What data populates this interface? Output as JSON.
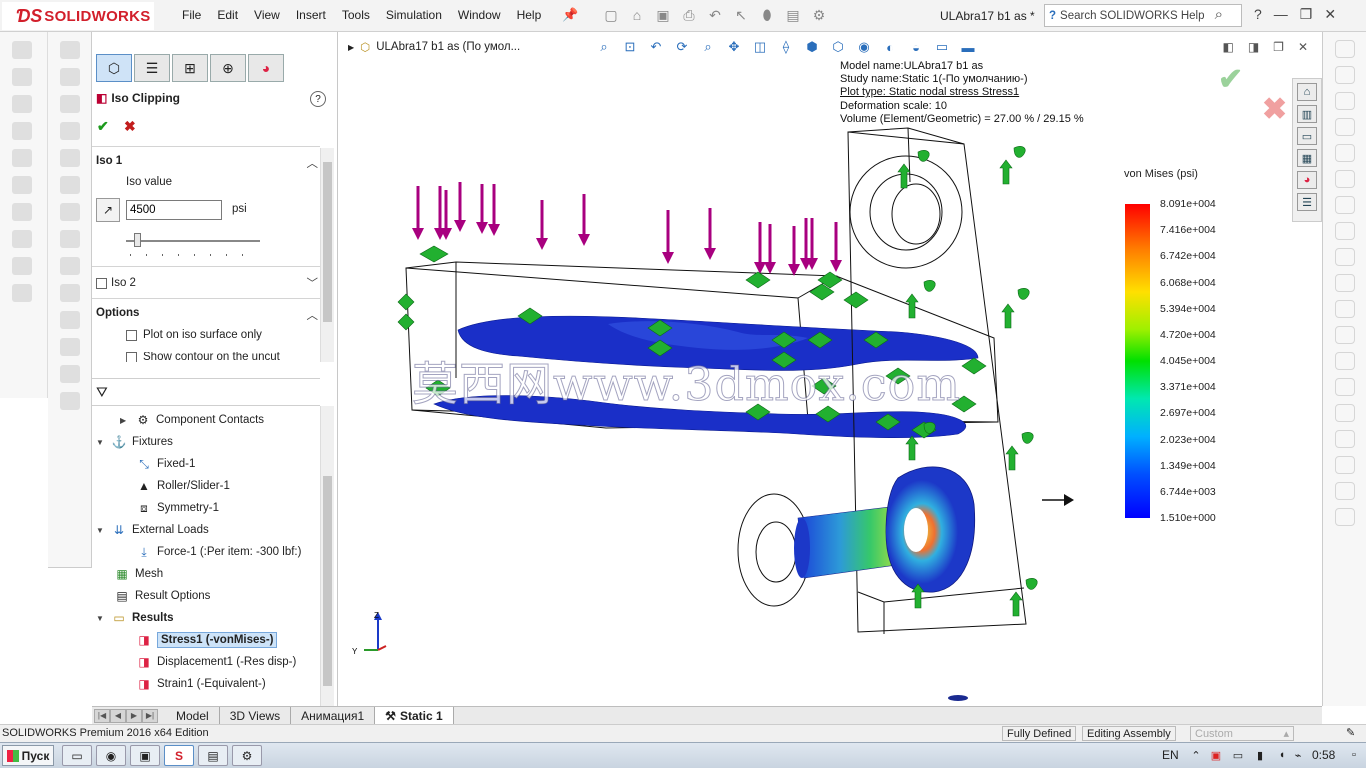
{
  "app": {
    "brand": "SOLIDWORKS",
    "menu": [
      "File",
      "Edit",
      "View",
      "Insert",
      "Tools",
      "Simulation",
      "Window",
      "Help"
    ],
    "doc_title": "ULAbra17 b1 as *",
    "search_placeholder": "Search SOLIDWORKS Help",
    "help_mark": "?"
  },
  "property_manager": {
    "title": "Iso Clipping",
    "iso1": {
      "label": "Iso 1",
      "value_label": "Iso value",
      "value": "4500",
      "unit": "psi",
      "slider_fraction": 0.08
    },
    "iso2_label": "Iso 2",
    "options_label": "Options",
    "option_plot_iso": "Plot on iso surface only",
    "option_show_contour": "Show contour on the uncut"
  },
  "tree": {
    "component_contacts": "Component Contacts",
    "fixtures": "Fixtures",
    "fixed": "Fixed-1",
    "roller": "Roller/Slider-1",
    "symmetry": "Symmetry-1",
    "external_loads": "External Loads",
    "force": "Force-1 (:Per item: -300 lbf:)",
    "mesh": "Mesh",
    "result_options": "Result Options",
    "results": "Results",
    "stress": "Stress1 (-vonMises-)",
    "displacement": "Displacement1 (-Res disp-)",
    "strain": "Strain1 (-Equivalent-)"
  },
  "graphics": {
    "breadcrumb": "ULAbra17 b1 as  (По умол...",
    "info": {
      "model_name": "Model name:ULAbra17 b1 as",
      "study_name": "Study name:Static 1(-По умолчанию-)",
      "plot_type": "Plot type: Static nodal stress Stress1",
      "deformation": "Deformation scale: 10",
      "volume": "Volume (Element/Geometric) = 27.00 % / 29.15 %"
    },
    "legend_title": "von Mises (psi)",
    "legend_values": [
      "8.091e+004",
      "7.416e+004",
      "6.742e+004",
      "6.068e+004",
      "5.394e+004",
      "4.720e+004",
      "4.045e+004",
      "3.371e+004",
      "2.697e+004",
      "2.023e+004",
      "1.349e+004",
      "6.744e+003",
      "1.510e+000"
    ],
    "watermark": "莫西网www.3dmox.com"
  },
  "bottom_tabs": [
    "Model",
    "3D Views",
    "Анимация1",
    "Static 1"
  ],
  "status": {
    "edition": "SOLIDWORKS Premium 2016 x64 Edition",
    "defined": "Fully Defined",
    "editing": "Editing Assembly",
    "units": "Custom"
  },
  "taskbar": {
    "start": "Пуск",
    "lang": "EN",
    "time": "0:58"
  },
  "colors": {
    "accent": "#d21f2b",
    "ok_green": "#1d9a1d",
    "cancel_red": "#c21d1d",
    "mesh_blue": "#1430c8",
    "load_magenta": "#b0008a",
    "fixture_green": "#22b030"
  }
}
